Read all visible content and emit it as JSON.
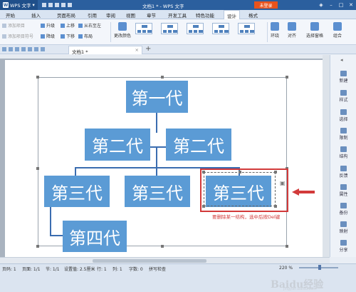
{
  "titlebar": {
    "app_name": "WPS 文字",
    "window_title": "文档1 * - WPS 文字",
    "login_label": "未登录",
    "accent": "#2b5f9e"
  },
  "tabs": [
    {
      "label": "开始"
    },
    {
      "label": "插入"
    },
    {
      "label": "页面布局"
    },
    {
      "label": "引用"
    },
    {
      "label": "审阅"
    },
    {
      "label": "视图"
    },
    {
      "label": "章节"
    },
    {
      "label": "开发工具"
    },
    {
      "label": "特色功能"
    },
    {
      "label": "设计"
    },
    {
      "label": "格式"
    }
  ],
  "ribbon": {
    "add_shape": "添加项目",
    "add_assistant": "添加项目符号",
    "promote": "升级",
    "demote": "降级",
    "move_up": "上移",
    "move_down": "下移",
    "right_to_left": "从右至左",
    "layout": "布局",
    "change_colors": "更改颜色",
    "wrap": "环绕",
    "align": "对齐",
    "select_pane": "选择窗格",
    "combine": "组合"
  },
  "document": {
    "tab_title": "文档1 *"
  },
  "org_chart": {
    "level1": "第一代",
    "level2_left": "第二代",
    "level2_right": "第二代",
    "level3_left": "第三代",
    "level3_mid": "第三代",
    "level3_right": "第三代",
    "level4": "第四代",
    "node_color": "#5b9bd5"
  },
  "annotation": {
    "callout": "要删除某一结构，选中后按Del键",
    "color": "#d23a3a"
  },
  "sidepanel": [
    {
      "label": "新建",
      "icon": "new-icon"
    },
    {
      "label": "样式",
      "icon": "style-icon"
    },
    {
      "label": "选择",
      "icon": "select-icon"
    },
    {
      "label": "限制",
      "icon": "restrict-icon"
    },
    {
      "label": "结构",
      "icon": "structure-icon"
    },
    {
      "label": "反馈",
      "icon": "feedback-icon"
    },
    {
      "label": "属性",
      "icon": "property-icon"
    },
    {
      "label": "备份",
      "icon": "backup-icon"
    },
    {
      "label": "映射",
      "icon": "map-icon"
    },
    {
      "label": "分享",
      "icon": "share-icon"
    }
  ],
  "status": {
    "page": "页码: 1",
    "pages": "页面: 1/1",
    "section": "节: 1/1",
    "position": "设置值: 2.5厘米",
    "row": "行: 1",
    "col": "列: 1",
    "words": "字数: 0",
    "spell": "拼写检查",
    "zoom": "220 %"
  },
  "watermark": {
    "text": "Baidu经验",
    "sub": "jingyan.baidu.com"
  }
}
